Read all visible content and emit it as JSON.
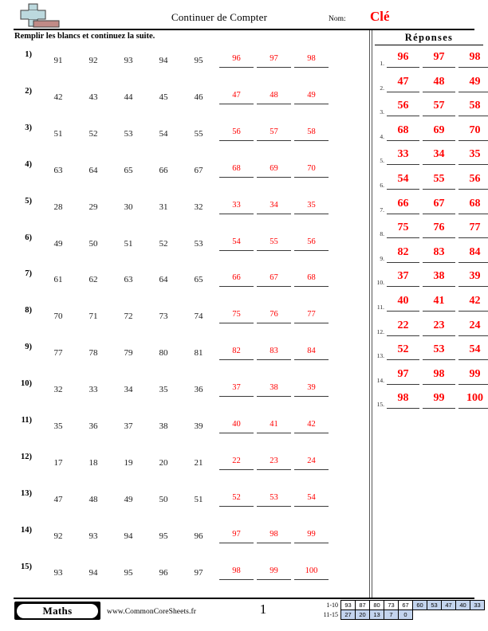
{
  "header": {
    "logo_icon": "plus-block-logo",
    "title": "Continuer de Compter",
    "name_label": "Nom:",
    "name_value": "Clé",
    "instructions": "Remplir les blancs et continuez la suite."
  },
  "answer_panel": {
    "title": "Réponses",
    "rows": [
      {
        "num": "1.",
        "values": [
          "96",
          "97",
          "98"
        ]
      },
      {
        "num": "2.",
        "values": [
          "47",
          "48",
          "49"
        ]
      },
      {
        "num": "3.",
        "values": [
          "56",
          "57",
          "58"
        ]
      },
      {
        "num": "4.",
        "values": [
          "68",
          "69",
          "70"
        ]
      },
      {
        "num": "5.",
        "values": [
          "33",
          "34",
          "35"
        ]
      },
      {
        "num": "6.",
        "values": [
          "54",
          "55",
          "56"
        ]
      },
      {
        "num": "7.",
        "values": [
          "66",
          "67",
          "68"
        ]
      },
      {
        "num": "8.",
        "values": [
          "75",
          "76",
          "77"
        ]
      },
      {
        "num": "9.",
        "values": [
          "82",
          "83",
          "84"
        ]
      },
      {
        "num": "10.",
        "values": [
          "37",
          "38",
          "39"
        ]
      },
      {
        "num": "11.",
        "values": [
          "40",
          "41",
          "42"
        ]
      },
      {
        "num": "12.",
        "values": [
          "22",
          "23",
          "24"
        ]
      },
      {
        "num": "13.",
        "values": [
          "52",
          "53",
          "54"
        ]
      },
      {
        "num": "14.",
        "values": [
          "97",
          "98",
          "99"
        ]
      },
      {
        "num": "15.",
        "values": [
          "98",
          "99",
          "100"
        ]
      }
    ]
  },
  "problems": [
    {
      "index": "1)",
      "given": [
        "91",
        "92",
        "93",
        "94",
        "95"
      ],
      "answers": [
        "96",
        "97",
        "98"
      ]
    },
    {
      "index": "2)",
      "given": [
        "42",
        "43",
        "44",
        "45",
        "46"
      ],
      "answers": [
        "47",
        "48",
        "49"
      ]
    },
    {
      "index": "3)",
      "given": [
        "51",
        "52",
        "53",
        "54",
        "55"
      ],
      "answers": [
        "56",
        "57",
        "58"
      ]
    },
    {
      "index": "4)",
      "given": [
        "63",
        "64",
        "65",
        "66",
        "67"
      ],
      "answers": [
        "68",
        "69",
        "70"
      ]
    },
    {
      "index": "5)",
      "given": [
        "28",
        "29",
        "30",
        "31",
        "32"
      ],
      "answers": [
        "33",
        "34",
        "35"
      ]
    },
    {
      "index": "6)",
      "given": [
        "49",
        "50",
        "51",
        "52",
        "53"
      ],
      "answers": [
        "54",
        "55",
        "56"
      ]
    },
    {
      "index": "7)",
      "given": [
        "61",
        "62",
        "63",
        "64",
        "65"
      ],
      "answers": [
        "66",
        "67",
        "68"
      ]
    },
    {
      "index": "8)",
      "given": [
        "70",
        "71",
        "72",
        "73",
        "74"
      ],
      "answers": [
        "75",
        "76",
        "77"
      ]
    },
    {
      "index": "9)",
      "given": [
        "77",
        "78",
        "79",
        "80",
        "81"
      ],
      "answers": [
        "82",
        "83",
        "84"
      ]
    },
    {
      "index": "10)",
      "given": [
        "32",
        "33",
        "34",
        "35",
        "36"
      ],
      "answers": [
        "37",
        "38",
        "39"
      ]
    },
    {
      "index": "11)",
      "given": [
        "35",
        "36",
        "37",
        "38",
        "39"
      ],
      "answers": [
        "40",
        "41",
        "42"
      ]
    },
    {
      "index": "12)",
      "given": [
        "17",
        "18",
        "19",
        "20",
        "21"
      ],
      "answers": [
        "22",
        "23",
        "24"
      ]
    },
    {
      "index": "13)",
      "given": [
        "47",
        "48",
        "49",
        "50",
        "51"
      ],
      "answers": [
        "52",
        "53",
        "54"
      ]
    },
    {
      "index": "14)",
      "given": [
        "92",
        "93",
        "94",
        "95",
        "96"
      ],
      "answers": [
        "97",
        "98",
        "99"
      ]
    },
    {
      "index": "15)",
      "given": [
        "93",
        "94",
        "95",
        "96",
        "97"
      ],
      "answers": [
        "98",
        "99",
        "100"
      ]
    }
  ],
  "footer": {
    "brand": "Maths",
    "site_url": "www.CommonCoreSheets.fr",
    "page_number": "1"
  },
  "score_table": {
    "highlight_color": "#c3d4ee",
    "rows": [
      {
        "label": "1-10",
        "cells": [
          {
            "value": "93",
            "highlight": false
          },
          {
            "value": "87",
            "highlight": false
          },
          {
            "value": "80",
            "highlight": false
          },
          {
            "value": "73",
            "highlight": false
          },
          {
            "value": "67",
            "highlight": false
          },
          {
            "value": "60",
            "highlight": true
          },
          {
            "value": "53",
            "highlight": true
          },
          {
            "value": "47",
            "highlight": true
          },
          {
            "value": "40",
            "highlight": true
          },
          {
            "value": "33",
            "highlight": true
          }
        ]
      },
      {
        "label": "11-15",
        "cells": [
          {
            "value": "27",
            "highlight": true
          },
          {
            "value": "20",
            "highlight": true
          },
          {
            "value": "13",
            "highlight": true
          },
          {
            "value": "7",
            "highlight": true
          },
          {
            "value": "0",
            "highlight": true
          }
        ]
      }
    ]
  }
}
